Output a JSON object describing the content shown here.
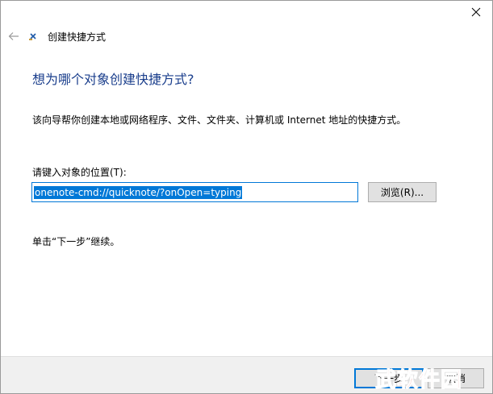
{
  "window": {
    "title": "创建快捷方式"
  },
  "wizard": {
    "heading": "想为哪个对象创建快捷方式?",
    "description": "该向导帮你创建本地或网络程序、文件、文件夹、计算机或 Internet 地址的快捷方式。",
    "location_label": "请键入对象的位置(T):",
    "location_value": "onenote-cmd://quicknote/?onOpen=typing",
    "browse_label": "浏览(R)...",
    "hint": "单击“下一步”继续。"
  },
  "footer": {
    "next_label": "下一步",
    "cancel_label": "取消"
  },
  "watermark": {
    "text": "武软件园"
  },
  "colors": {
    "heading": "#1a3e8c",
    "accent": "#0078d7",
    "button_face": "#e1e1e1",
    "footer_bg": "#f0f0f0",
    "watermark": "#d9413a"
  }
}
